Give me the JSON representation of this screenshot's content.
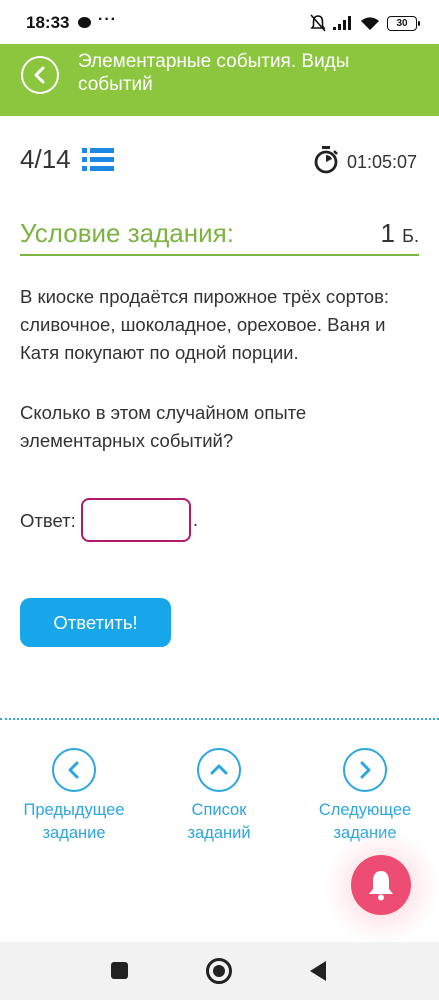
{
  "status_bar": {
    "time": "18:33",
    "dots": "···",
    "battery": "30"
  },
  "header": {
    "title": "Элементарные события. Виды событий"
  },
  "task": {
    "number": "4",
    "total": "/14",
    "timer": "01:05:07"
  },
  "condition": {
    "title": "Условие задания:",
    "points": "1",
    "points_unit": "Б."
  },
  "problem": {
    "text": "В киоске продаётся пирожное трёх сортов: сливочное, шоколадное, ореховое. Ваня и Катя покупают по одной порции.",
    "question": "Сколько в этом случайном опыте элементарных событий?"
  },
  "answer": {
    "label": "Ответ:",
    "value": "",
    "suffix": "."
  },
  "submit": {
    "label": "Ответить!"
  },
  "nav": {
    "prev": {
      "line1": "Предыдущее",
      "line2": "задание"
    },
    "list": {
      "line1": "Список",
      "line2": "заданий"
    },
    "next": {
      "line1": "Следующее",
      "line2": "задание"
    }
  },
  "colors": {
    "header": "#8cc63f",
    "accent_green": "#7cb342",
    "accent_blue": "#16a6e9",
    "input_border": "#b0196e",
    "bell": "#ee4d73"
  },
  "icons": [
    "chat-icon",
    "dnd-icon",
    "signal-icon",
    "wifi-icon",
    "battery-icon",
    "back-arrow-icon",
    "list-icon",
    "stopwatch-icon",
    "chevron-left-icon",
    "chevron-up-icon",
    "chevron-right-icon",
    "bell-icon"
  ]
}
